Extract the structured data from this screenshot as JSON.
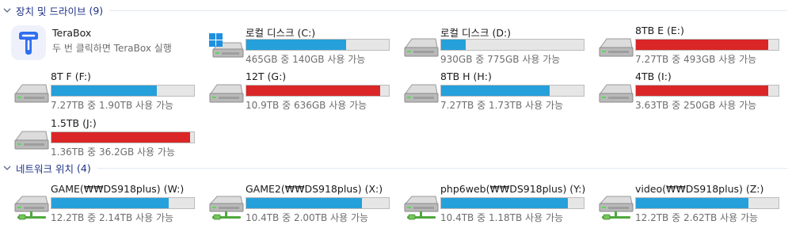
{
  "sections": {
    "devices": {
      "title": "장치 및 드라이브",
      "count": "(9)"
    },
    "network": {
      "title": "네트워크 위치",
      "count": "(4)"
    }
  },
  "app": {
    "name": "TeraBox",
    "subtitle": "두 번 클릭하면 TeraBox 실행"
  },
  "drives": [
    {
      "name": "로컬 디스크 (C:)",
      "info": "465GB 중 140GB 사용 가능",
      "used": 0.7,
      "color": "#26a0da",
      "icon": "windows-drive-icon"
    },
    {
      "name": "로컬 디스크 (D:)",
      "info": "930GB 중 775GB 사용 가능",
      "used": 0.17,
      "color": "#26a0da",
      "icon": "hard-drive-icon"
    },
    {
      "name": "8TB E (E:)",
      "info": "7.27TB 중 493GB 사용 가능",
      "used": 0.93,
      "color": "#da2626",
      "icon": "hard-drive-icon"
    },
    {
      "name": "8T F (F:)",
      "info": "7.27TB 중 1.90TB 사용 가능",
      "used": 0.74,
      "color": "#26a0da",
      "icon": "hard-drive-icon"
    },
    {
      "name": "12T (G:)",
      "info": "10.9TB 중 636GB 사용 가능",
      "used": 0.94,
      "color": "#da2626",
      "icon": "hard-drive-icon"
    },
    {
      "name": "8TB H (H:)",
      "info": "7.27TB 중 1.73TB 사용 가능",
      "used": 0.76,
      "color": "#26a0da",
      "icon": "hard-drive-icon"
    },
    {
      "name": "4TB (I:)",
      "info": "3.63TB 중 250GB 사용 가능",
      "used": 0.93,
      "color": "#da2626",
      "icon": "hard-drive-icon"
    },
    {
      "name": "1.5TB (J:)",
      "info": "1.36TB 중 36.2GB 사용 가능",
      "used": 0.97,
      "color": "#da2626",
      "icon": "hard-drive-icon"
    }
  ],
  "network_drives": [
    {
      "name": "GAME(₩₩DS918plus) (W:)",
      "info": "12.2TB 중 2.14TB 사용 가능",
      "used": 0.82,
      "color": "#26a0da",
      "icon": "network-drive-icon"
    },
    {
      "name": "GAME2(₩₩DS918plus) (X:)",
      "info": "10.4TB 중 2.00TB 사용 가능",
      "used": 0.81,
      "color": "#26a0da",
      "icon": "network-drive-icon"
    },
    {
      "name": "php6web(₩₩DS918plus) (Y:)",
      "info": "10.4TB 중 1.18TB 사용 가능",
      "used": 0.89,
      "color": "#26a0da",
      "icon": "network-drive-icon"
    },
    {
      "name": "video(₩₩DS918plus) (Z:)",
      "info": "12.2TB 중 2.62TB 사용 가능",
      "used": 0.79,
      "color": "#26a0da",
      "icon": "network-drive-icon"
    }
  ]
}
